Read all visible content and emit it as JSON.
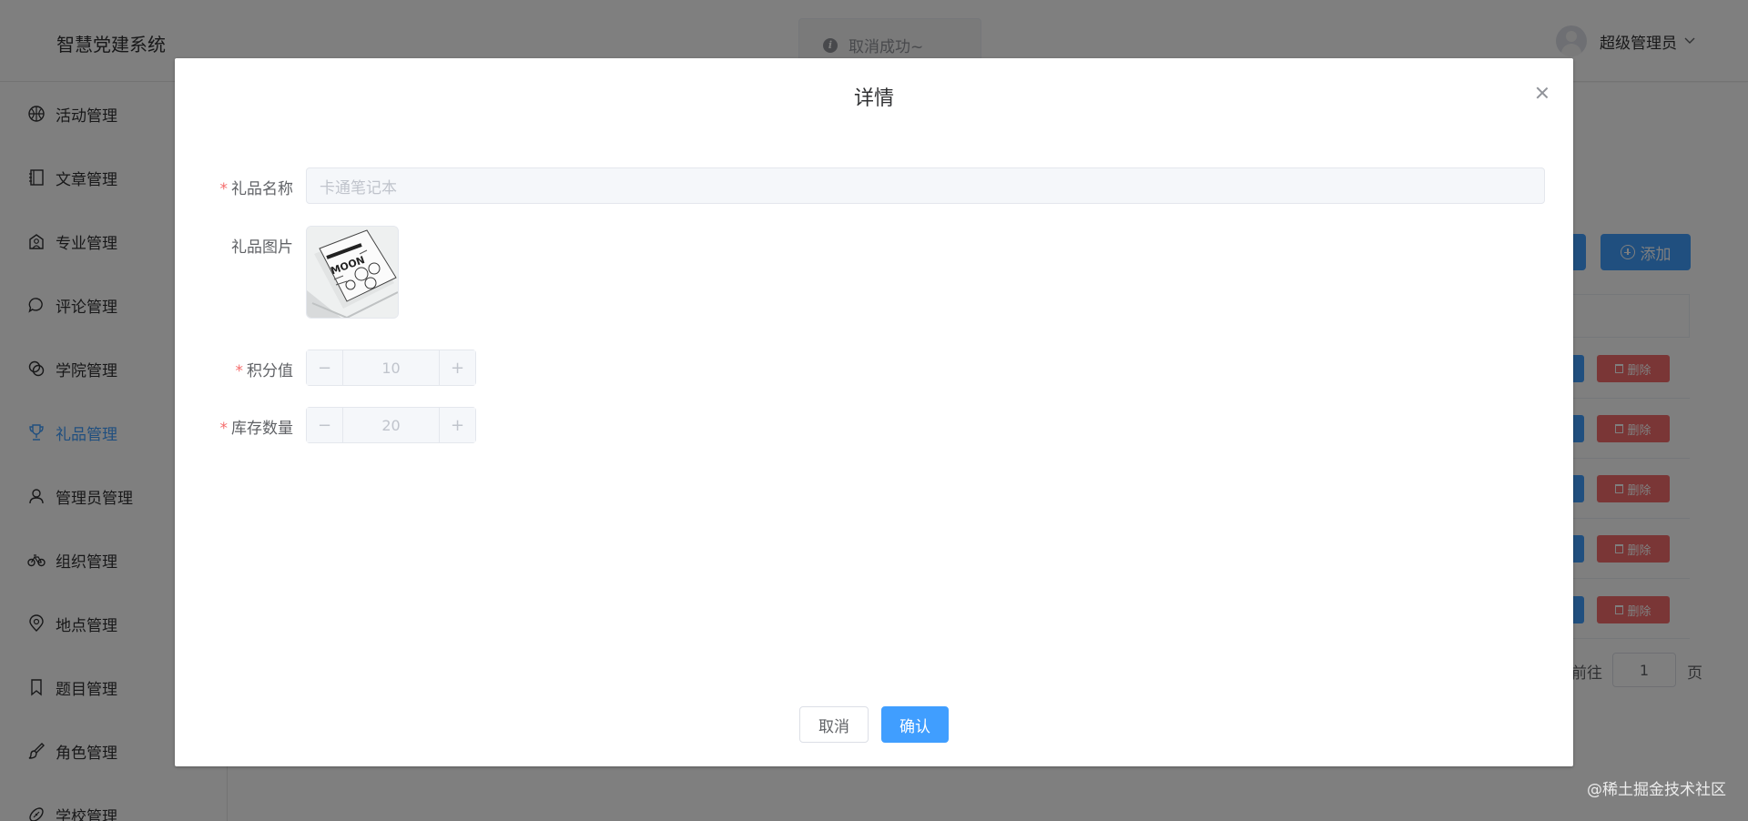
{
  "app": {
    "title": "智慧党建系统"
  },
  "user": {
    "name": "超级管理员"
  },
  "toast": {
    "message": "取消成功~"
  },
  "sidebar": {
    "items": [
      {
        "label": "活动管理",
        "icon": "basketball-icon"
      },
      {
        "label": "文章管理",
        "icon": "notebook-icon"
      },
      {
        "label": "专业管理",
        "icon": "school-icon"
      },
      {
        "label": "评论管理",
        "icon": "chat-bubble-icon"
      },
      {
        "label": "学院管理",
        "icon": "link-rings-icon"
      },
      {
        "label": "礼品管理",
        "icon": "trophy-icon"
      },
      {
        "label": "管理员管理",
        "icon": "user-icon"
      },
      {
        "label": "组织管理",
        "icon": "bicycle-icon"
      },
      {
        "label": "地点管理",
        "icon": "location-icon"
      },
      {
        "label": "题目管理",
        "icon": "bookmark-icon"
      },
      {
        "label": "角色管理",
        "icon": "brush-icon"
      },
      {
        "label": "学校管理",
        "icon": "football-icon"
      }
    ],
    "active_index": 5
  },
  "main": {
    "add_button": "添加",
    "delete_label": "删除",
    "pager": {
      "goto": "前往",
      "page_value": "1",
      "page_suffix": "页"
    }
  },
  "dialog": {
    "title": "详情",
    "fields": {
      "name": {
        "label": "礼品名称",
        "placeholder": "卡通笔记本"
      },
      "image": {
        "label": "礼品图片"
      },
      "points": {
        "label": "积分值",
        "value": "10"
      },
      "stock": {
        "label": "库存数量",
        "value": "20"
      }
    },
    "cancel": "取消",
    "confirm": "确认"
  },
  "watermark": "@稀土掘金技术社区",
  "colors": {
    "primary": "#409eff",
    "danger": "#f56c6c",
    "required": "#f56c6c"
  }
}
